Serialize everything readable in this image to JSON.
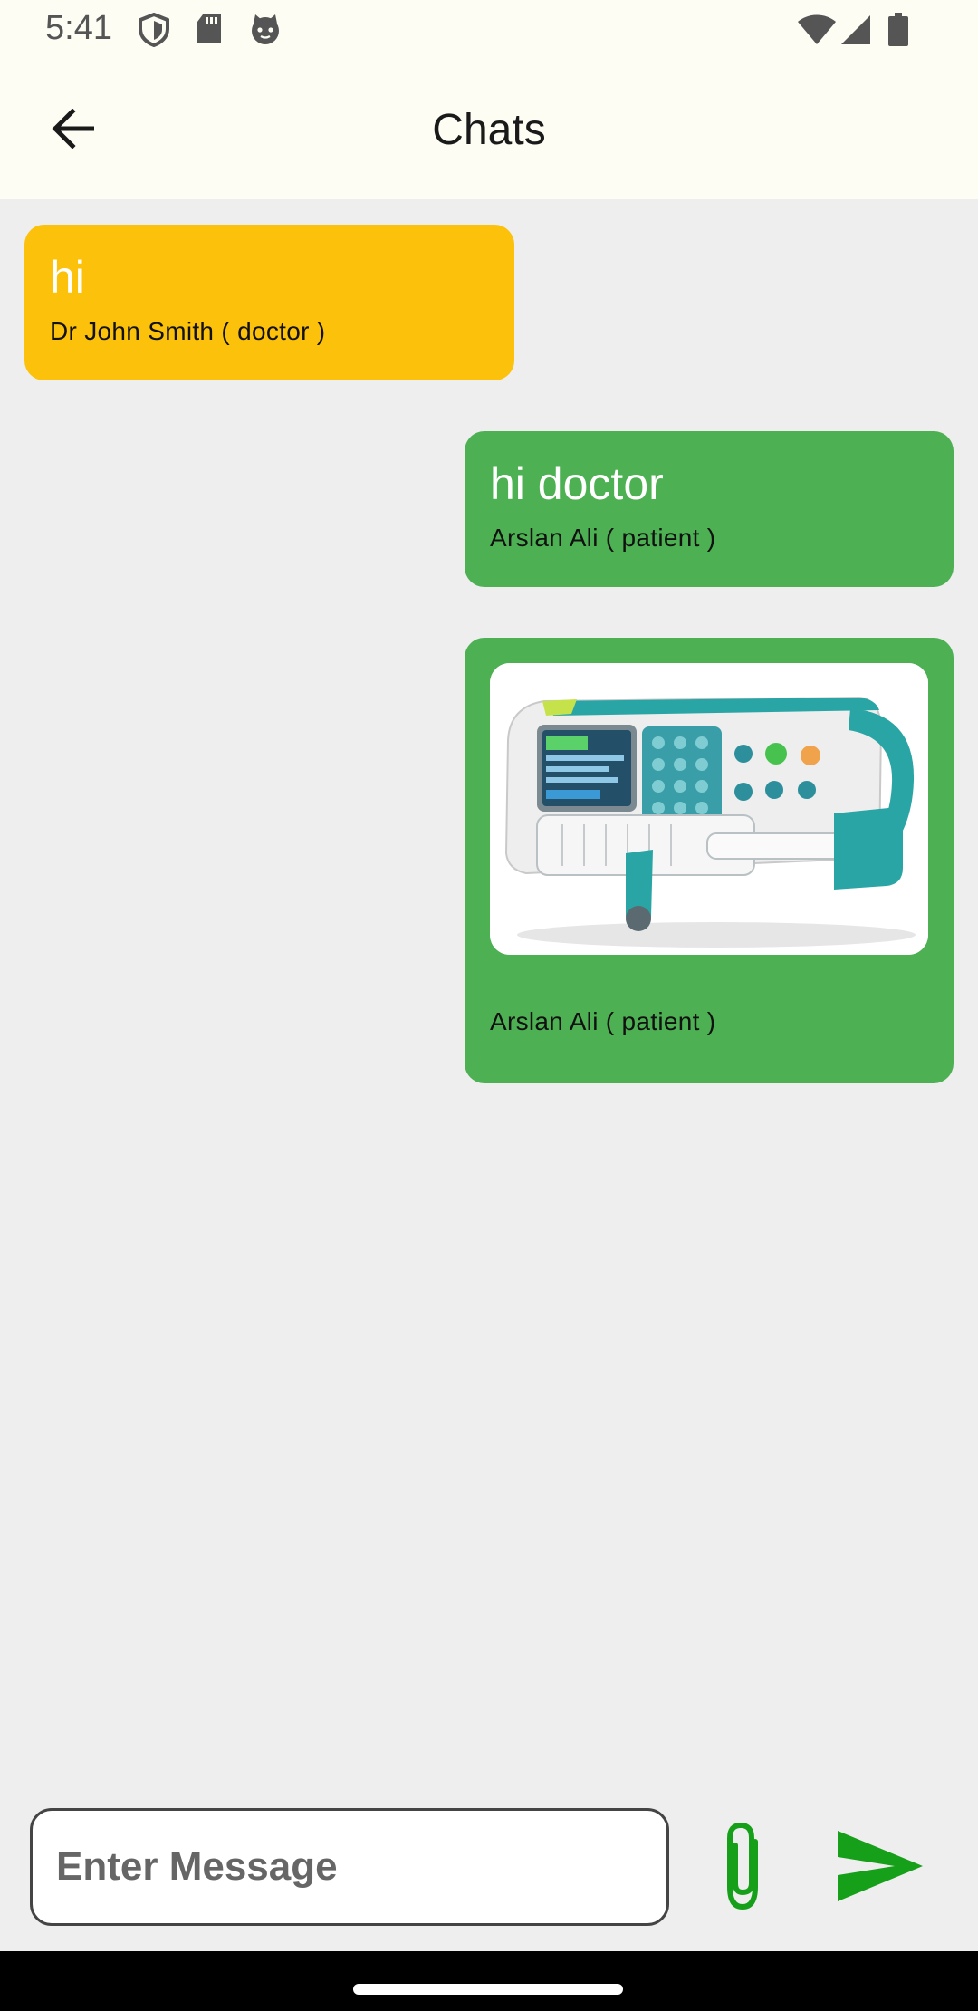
{
  "status_bar": {
    "time": "5:41",
    "icons_left": [
      "shield-icon",
      "sd-card-icon",
      "cat-face-icon"
    ],
    "icons_right": [
      "wifi-icon",
      "cellular-signal-icon",
      "battery-icon"
    ]
  },
  "app_bar": {
    "title": "Chats",
    "back_icon": "arrow-left-icon"
  },
  "messages": [
    {
      "direction": "incoming",
      "text": "hi",
      "sender": "Dr John Smith ( doctor )",
      "color": "#fcc10a"
    },
    {
      "direction": "outgoing",
      "text": "hi doctor",
      "sender": "Arslan Ali ( patient )",
      "color": "#4db052"
    },
    {
      "direction": "outgoing",
      "type": "image",
      "image_subject": "syringe-pump-device",
      "sender": "Arslan Ali ( patient )",
      "color": "#4db052"
    }
  ],
  "composer": {
    "placeholder": "Enter Message",
    "value": "",
    "attach_icon": "paperclip-icon",
    "send_icon": "send-icon",
    "accent_color": "#16a01a"
  },
  "colors": {
    "background": "#eeeeee",
    "app_bar": "#fdfdf4",
    "incoming_bubble": "#fcc10a",
    "outgoing_bubble": "#4db052"
  }
}
